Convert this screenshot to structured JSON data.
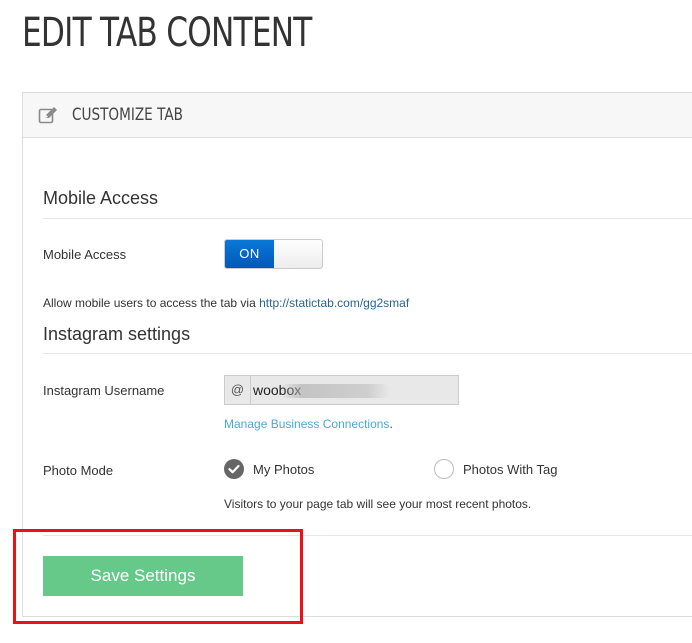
{
  "page": {
    "title": "EDIT TAB CONTENT"
  },
  "panel": {
    "header_title": "CUSTOMIZE TAB",
    "header_icon": "edit-icon"
  },
  "mobile": {
    "section_title": "Mobile Access",
    "label": "Mobile Access",
    "toggle_on_label": "ON",
    "toggle_state": "on",
    "help_prefix": "Allow mobile users to access the tab via ",
    "help_link": "http://statictab.com/gg2smaf"
  },
  "instagram": {
    "section_title": "Instagram settings",
    "username_label": "Instagram Username",
    "username_prefix": "@",
    "username_value": "woobox",
    "manage_link": "Manage Business Connections",
    "manage_link_suffix": ".",
    "photo_mode_label": "Photo Mode",
    "photo_mode_options": [
      {
        "label": "My Photos",
        "selected": true
      },
      {
        "label": "Photos With Tag",
        "selected": false
      }
    ],
    "photo_mode_help": "Visitors to your page tab will see your most recent photos."
  },
  "actions": {
    "save_label": "Save Settings"
  },
  "colors": {
    "toggle_on": "#0a6fd0",
    "save_button": "#66c98a",
    "highlight": "#ee1111",
    "link": "#2a6496",
    "manage_link": "#4aa8d8"
  }
}
